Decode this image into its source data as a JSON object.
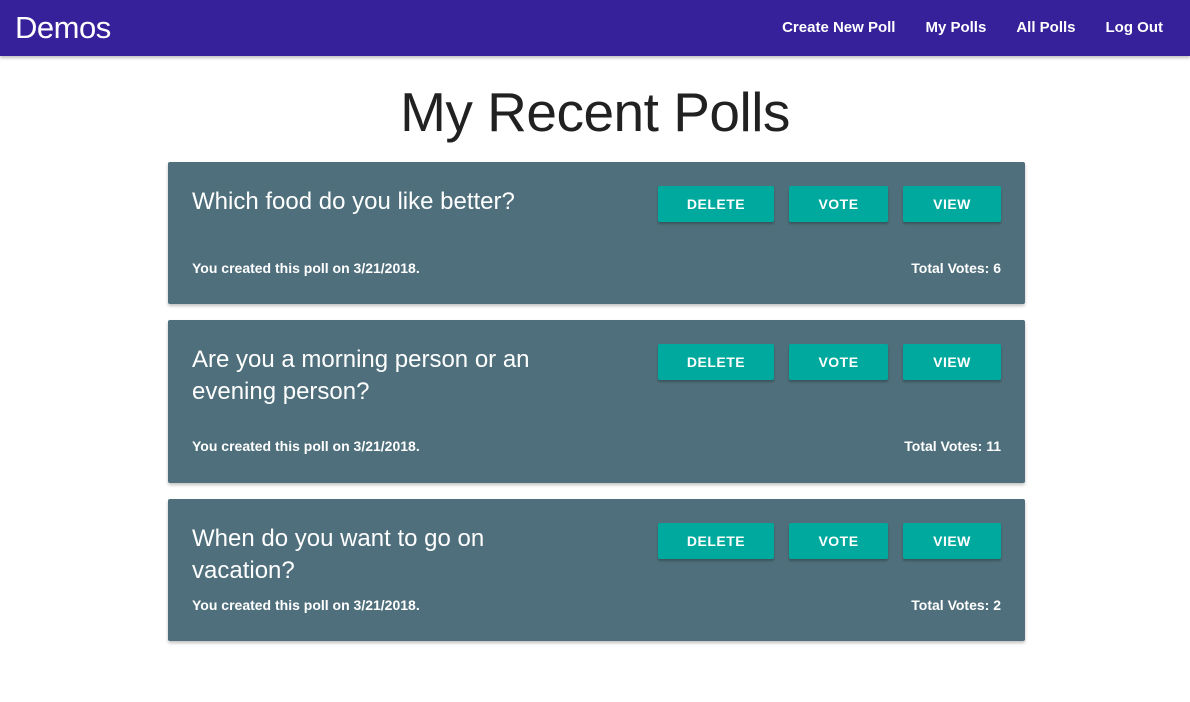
{
  "nav": {
    "brand": "Demos",
    "links": [
      "Create New Poll",
      "My Polls",
      "All Polls",
      "Log Out"
    ]
  },
  "main": {
    "title": "My Recent Polls"
  },
  "polls": [
    {
      "question": "Which food do you like better?",
      "buttons": [
        "DELETE",
        "VOTE",
        "VIEW"
      ],
      "created": "You created this poll on 3/21/2018.",
      "total_votes": "Total Votes: 6"
    },
    {
      "question": "Are you a morning person or an evening person?",
      "buttons": [
        "DELETE",
        "VOTE",
        "VIEW"
      ],
      "created": "You created this poll on 3/21/2018.",
      "total_votes": "Total Votes: 11"
    },
    {
      "question": "When do you want to go on vacation?",
      "buttons": [
        "DELETE",
        "VOTE",
        "VIEW"
      ],
      "created": "You created this poll on 3/21/2018.",
      "total_votes": "Total Votes: 2"
    }
  ],
  "colors": {
    "navbar": "#36219a",
    "card": "#4e6f7b",
    "button": "#00a99d"
  }
}
